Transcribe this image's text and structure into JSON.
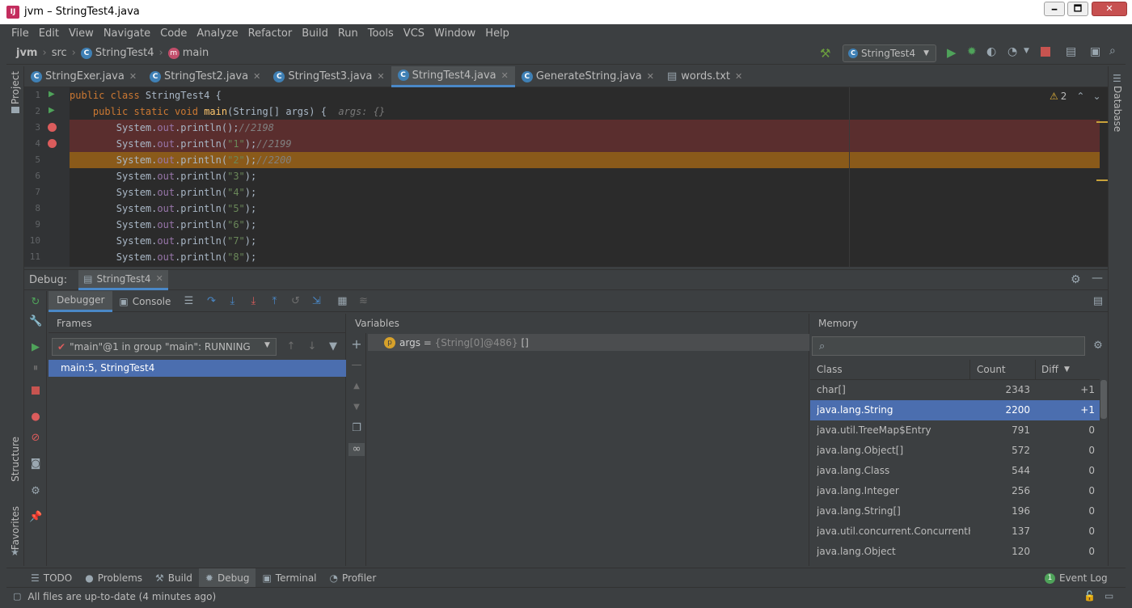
{
  "window": {
    "title": "jvm – StringTest4.java",
    "minimize": "🗕",
    "maximize": "🗖",
    "close": "✕"
  },
  "menu": [
    "File",
    "Edit",
    "View",
    "Navigate",
    "Code",
    "Analyze",
    "Refactor",
    "Build",
    "Run",
    "Tools",
    "VCS",
    "Window",
    "Help"
  ],
  "nav": {
    "project": "jvm",
    "src": "src",
    "cls": "StringTest4",
    "method": "main",
    "run_config": "StringTest4"
  },
  "tabs": [
    {
      "label": "StringExer.java",
      "icon": "C"
    },
    {
      "label": "StringTest2.java",
      "icon": "C"
    },
    {
      "label": "StringTest3.java",
      "icon": "C"
    },
    {
      "label": "StringTest4.java",
      "icon": "C",
      "active": true
    },
    {
      "label": "GenerateString.java",
      "icon": "C"
    },
    {
      "label": "words.txt",
      "icon": "file"
    }
  ],
  "left_strip": {
    "project": "Project",
    "structure": "Structure",
    "favorites": "Favorites"
  },
  "right_strip": {
    "database": "Database"
  },
  "editor": {
    "warnings": "2",
    "lines": [
      {
        "n": "1",
        "html": "<span class='kw'>public class </span><span>StringTest4 {</span>"
      },
      {
        "n": "2",
        "html": "    <span class='kw'>public static void </span><span class='cls'>main</span>(String[] args) {  <span class='hint'>args: {}</span>"
      },
      {
        "n": "3",
        "html": "        System.<span class='fld'>out</span>.println();<span class='cmt'>//2198</span>"
      },
      {
        "n": "4",
        "html": "        System.<span class='fld'>out</span>.println(<span class='str'>\"1\"</span>);<span class='cmt'>//2199</span>"
      },
      {
        "n": "5",
        "html": "        System.<span class='fld'>out</span>.println(<span class='str'>\"2\"</span>);<span class='cmt'>//2200</span>"
      },
      {
        "n": "6",
        "html": "        System.<span class='fld'>out</span>.println(<span class='str'>\"3\"</span>);"
      },
      {
        "n": "7",
        "html": "        System.<span class='fld'>out</span>.println(<span class='str'>\"4\"</span>);"
      },
      {
        "n": "8",
        "html": "        System.<span class='fld'>out</span>.println(<span class='str'>\"5\"</span>);"
      },
      {
        "n": "9",
        "html": "        System.<span class='fld'>out</span>.println(<span class='str'>\"6\"</span>);"
      },
      {
        "n": "10",
        "html": "        System.<span class='fld'>out</span>.println(<span class='str'>\"7\"</span>);"
      },
      {
        "n": "11",
        "html": "        System.<span class='fld'>out</span>.println(<span class='str'>\"8\"</span>);"
      }
    ]
  },
  "debug": {
    "label": "Debug:",
    "session": "StringTest4",
    "debugger_tab": "Debugger",
    "console_tab": "Console",
    "frames_title": "Frames",
    "thread": "\"main\"@1 in group \"main\": RUNNING",
    "frame": "main:5, StringTest4",
    "variables_title": "Variables",
    "var_name": "args",
    "var_eq": " = ",
    "var_value": "{String[0]@486}",
    "var_extra": " []",
    "memory_title": "Memory",
    "mem_cols": {
      "cls": "Class",
      "count": "Count",
      "diff": "Diff"
    },
    "mem_rows": [
      {
        "cls": "char[]",
        "count": "2343",
        "diff": "+1"
      },
      {
        "cls": "java.lang.String",
        "count": "2200",
        "diff": "+1",
        "sel": true
      },
      {
        "cls": "java.util.TreeMap$Entry",
        "count": "791",
        "diff": "0"
      },
      {
        "cls": "java.lang.Object[]",
        "count": "572",
        "diff": "0"
      },
      {
        "cls": "java.lang.Class",
        "count": "544",
        "diff": "0"
      },
      {
        "cls": "java.lang.Integer",
        "count": "256",
        "diff": "0"
      },
      {
        "cls": "java.lang.String[]",
        "count": "196",
        "diff": "0"
      },
      {
        "cls": "java.util.concurrent.ConcurrentHa",
        "count": "137",
        "diff": "0"
      },
      {
        "cls": "java.lang.Object",
        "count": "120",
        "diff": "0"
      }
    ]
  },
  "bottom": {
    "todo": "TODO",
    "problems": "Problems",
    "build": "Build",
    "debug": "Debug",
    "terminal": "Terminal",
    "profiler": "Profiler",
    "event_log": "Event Log",
    "event_count": "1"
  },
  "status": "All files are up-to-date (4 minutes ago)"
}
